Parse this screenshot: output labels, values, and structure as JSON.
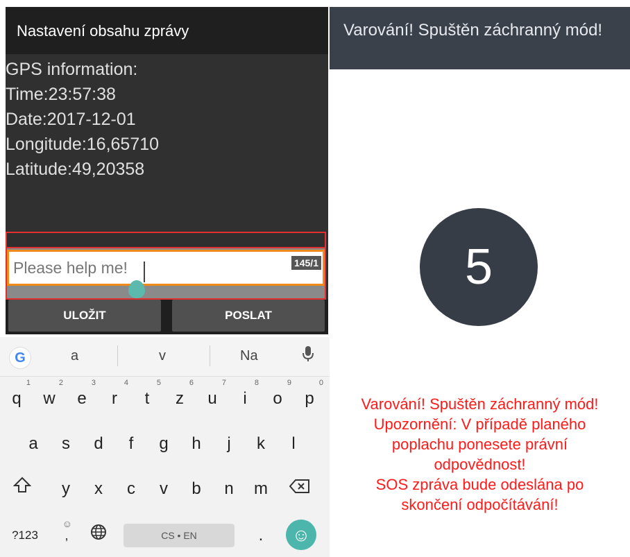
{
  "left": {
    "title": "Nastavení obsahu zprávy",
    "gps_lines": [
      "GPS information:",
      "Time:23:57:38",
      "Date:2017-12-01",
      "Longitude:16,65710",
      "Latitude:49,20358"
    ],
    "message_input": {
      "value": "Please help me!",
      "counter": "145/1"
    },
    "buttons": {
      "save": "ULOŽIT",
      "send": "POSLAT"
    },
    "suggestions": [
      "a",
      "v",
      "Na"
    ],
    "keyboard": {
      "row1": [
        {
          "k": "q",
          "n": "1"
        },
        {
          "k": "w",
          "n": "2"
        },
        {
          "k": "e",
          "n": "3"
        },
        {
          "k": "r",
          "n": "4"
        },
        {
          "k": "t",
          "n": "5"
        },
        {
          "k": "z",
          "n": "6"
        },
        {
          "k": "u",
          "n": "7"
        },
        {
          "k": "i",
          "n": "8"
        },
        {
          "k": "o",
          "n": "9"
        },
        {
          "k": "p",
          "n": "0"
        }
      ],
      "row2": [
        "a",
        "s",
        "d",
        "f",
        "g",
        "h",
        "j",
        "k",
        "l"
      ],
      "row3": [
        "y",
        "x",
        "c",
        "v",
        "b",
        "n",
        "m"
      ],
      "symbols_label": "?123",
      "space_label": "CS • EN",
      "period": "."
    }
  },
  "right": {
    "title": "Varování! Spuštěn záchranný mód!",
    "countdown": "5",
    "warning_lines": [
      "Varování! Spuštěn záchranný mód!",
      "Upozornění: V případě planého",
      "poplachu ponesete právní",
      "odpovědnost!",
      "SOS zpráva bude odeslána po",
      "skončení odpočítávání!"
    ]
  }
}
